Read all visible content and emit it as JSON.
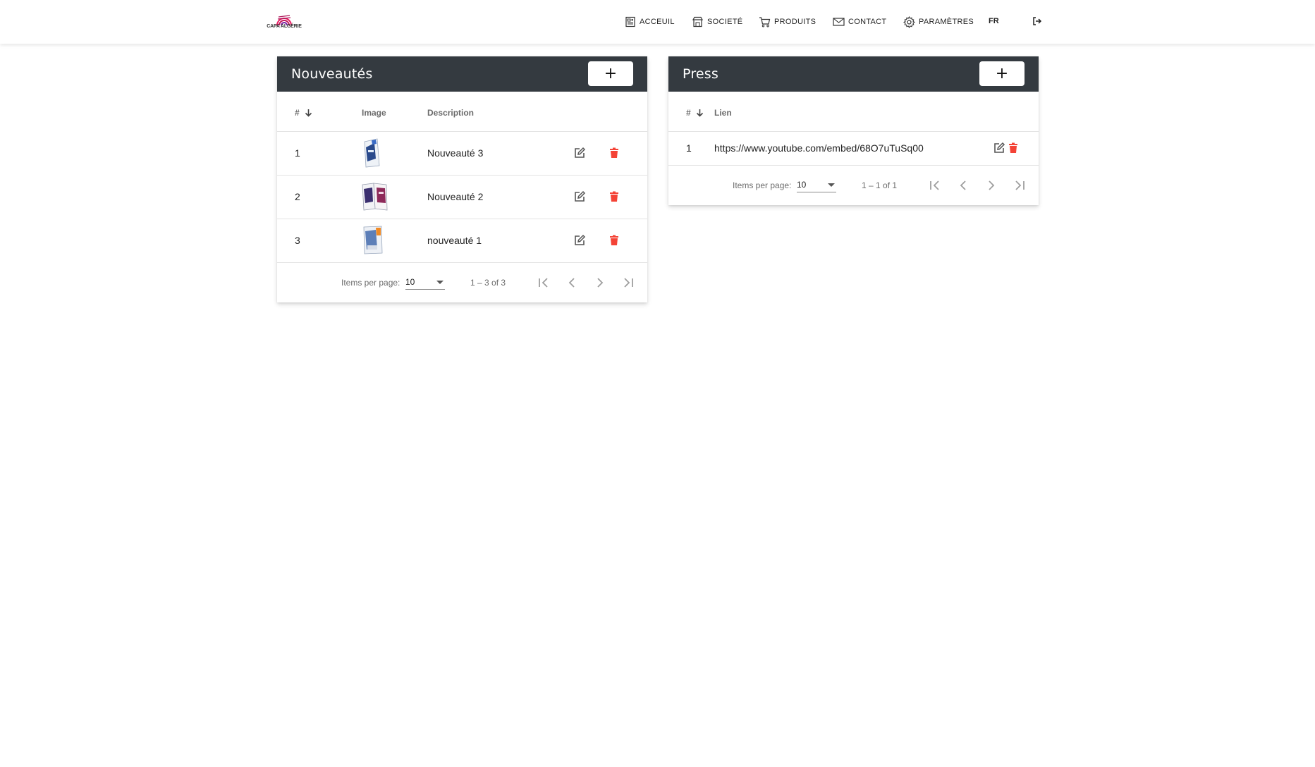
{
  "nav": {
    "logo_text": "CAPA ALGÉRIE",
    "items": [
      {
        "label": "ACCEUIL",
        "icon": "newspaper-icon"
      },
      {
        "label": "SOCIETÉ",
        "icon": "shop-icon"
      },
      {
        "label": "PRODUITS",
        "icon": "cart-icon"
      },
      {
        "label": "CONTACT",
        "icon": "envelope-icon"
      },
      {
        "label": "PARAMÈTRES",
        "icon": "gear-icon"
      }
    ],
    "lang": "FR",
    "logout_icon": "logout-icon"
  },
  "nouveautes": {
    "title": "Nouveautés",
    "add_label": "+",
    "columns": {
      "num": "#",
      "image": "Image",
      "description": "Description"
    },
    "rows": [
      {
        "num": "1",
        "description": "Nouveauté 3"
      },
      {
        "num": "2",
        "description": "Nouveauté 2"
      },
      {
        "num": "3",
        "description": "nouveauté 1"
      }
    ],
    "pager": {
      "label": "Items per page:",
      "page_size": "10",
      "range": "1 – 3 of 3"
    }
  },
  "press": {
    "title": "Press",
    "add_label": "+",
    "columns": {
      "num": "#",
      "link": "Lien"
    },
    "rows": [
      {
        "num": "1",
        "link": "https://www.youtube.com/embed/68O7uTuSq00"
      }
    ],
    "pager": {
      "label": "Items per page:",
      "page_size": "10",
      "range": "1 – 1 of 1"
    }
  },
  "colors": {
    "header_dark": "#343a40",
    "delete_red": "#f44336",
    "edit_gray": "#555555"
  }
}
